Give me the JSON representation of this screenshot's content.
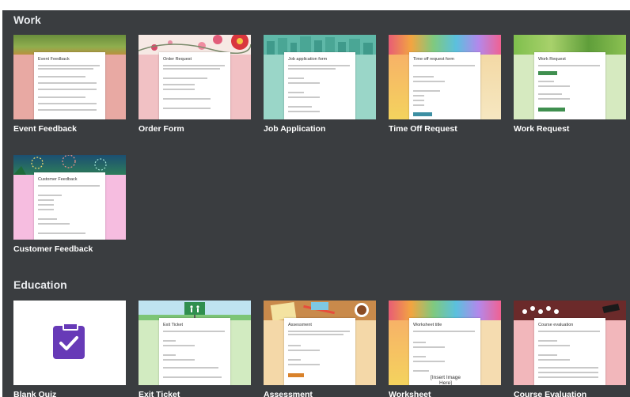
{
  "sections": [
    {
      "title": "Work"
    },
    {
      "title": "Education"
    }
  ],
  "work_templates": [
    {
      "label": "Event Feedback",
      "form_title": "Event Feedback"
    },
    {
      "label": "Order Form",
      "form_title": "Order Request"
    },
    {
      "label": "Job Application",
      "form_title": "Job application form"
    },
    {
      "label": "Time Off Request",
      "form_title": "Time off request form"
    },
    {
      "label": "Work Request",
      "form_title": "Work Request"
    },
    {
      "label": "Customer Feedback",
      "form_title": "Customer Feedback"
    }
  ],
  "education_templates": [
    {
      "label": "Blank Quiz",
      "form_title": ""
    },
    {
      "label": "Exit Ticket",
      "form_title": "Exit Ticket"
    },
    {
      "label": "Assessment",
      "form_title": "Assessment"
    },
    {
      "label": "Worksheet",
      "form_title": "Worksheet title",
      "insert_text": "[Insert Image Here]"
    },
    {
      "label": "Course Evaluation",
      "form_title": "Course evaluation"
    }
  ],
  "colors": {
    "background": "#3a3d40",
    "event_feedback": "#e8a9a3",
    "order_form": "#f1c1c4",
    "job_application": "#9ad6c8",
    "time_off": "#f3d9a5",
    "work_request": "#d6eac0",
    "customer_feedback": "#f6bde0",
    "exit_ticket": "#d2ebc1",
    "assessment": "#f4d8a8",
    "worksheet": "#f5dcb0",
    "course_evaluation": "#f2b7bb",
    "quiz_accent": "#673ab7"
  }
}
